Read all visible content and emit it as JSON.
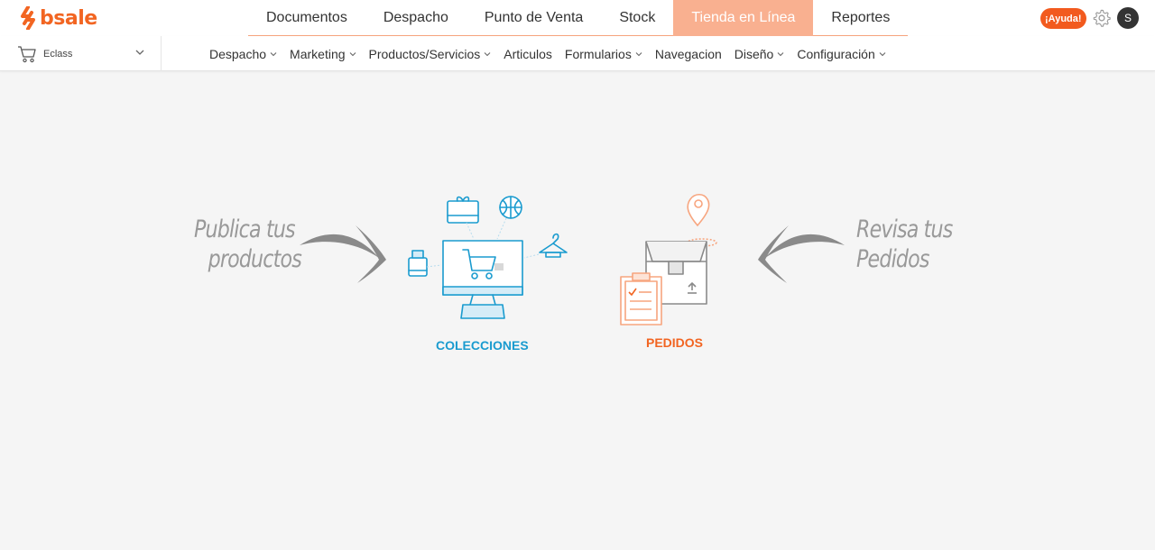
{
  "brand": {
    "name": "bsale",
    "color": "#f26522"
  },
  "main_nav": {
    "tabs": [
      {
        "label": "Documentos",
        "active": false
      },
      {
        "label": "Despacho",
        "active": false
      },
      {
        "label": "Punto de Venta",
        "active": false
      },
      {
        "label": "Stock",
        "active": false
      },
      {
        "label": "Tienda en Línea",
        "active": true
      },
      {
        "label": "Reportes",
        "active": false
      }
    ]
  },
  "header_right": {
    "help_label": "¡Ayuda!",
    "settings_icon": "gear-icon",
    "avatar_initial": "S"
  },
  "store_selector": {
    "icon": "cart-icon",
    "value": "Eclass"
  },
  "sub_nav": {
    "items": [
      {
        "label": "Despacho",
        "dropdown": true
      },
      {
        "label": "Marketing",
        "dropdown": true
      },
      {
        "label": "Productos/Servicios",
        "dropdown": true
      },
      {
        "label": "Articulos",
        "dropdown": false
      },
      {
        "label": "Formularios",
        "dropdown": true
      },
      {
        "label": "Navegacion",
        "dropdown": false
      },
      {
        "label": "Diseño",
        "dropdown": true
      },
      {
        "label": "Configuración",
        "dropdown": true
      }
    ]
  },
  "content": {
    "left_text": [
      "Publica tus",
      "productos"
    ],
    "right_text": [
      "Revisa tus",
      "Pedidos"
    ],
    "collections_label": "COLECCIONES",
    "orders_label": "PEDIDOS",
    "colors": {
      "collections": "#1a9bcf",
      "orders": "#f26522"
    }
  }
}
